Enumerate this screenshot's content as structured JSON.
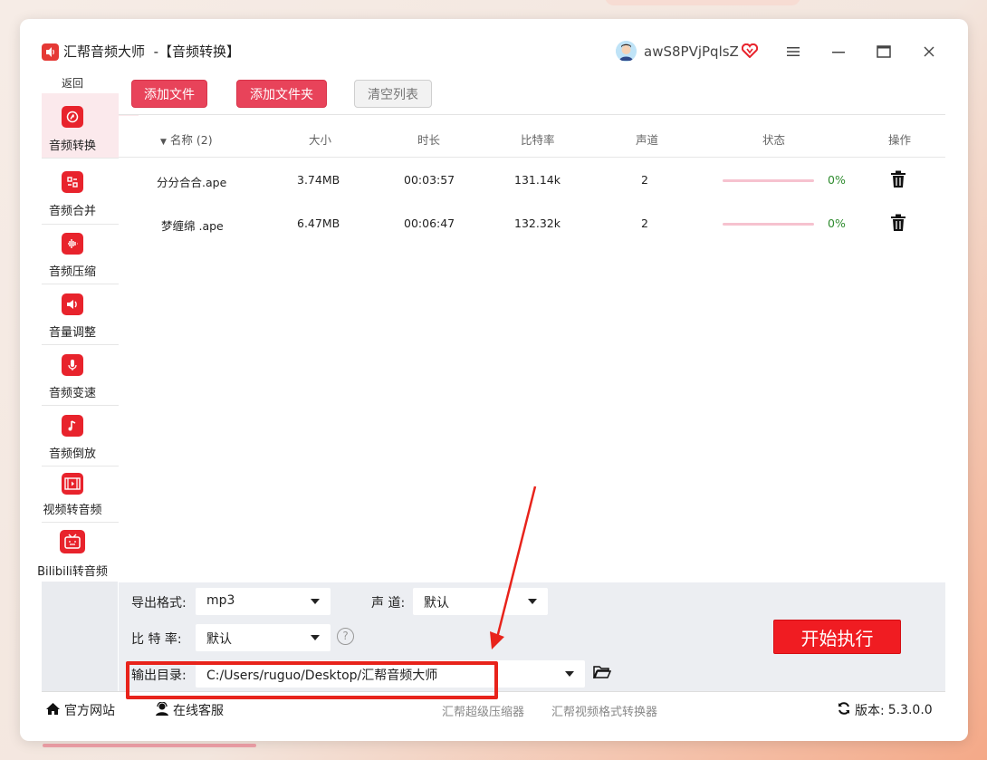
{
  "app": {
    "title": "汇帮音频大师",
    "subtitle": "-【音频转换】",
    "username": "awS8PVjPqlsZ",
    "accent_color": "#e8435a",
    "icons": [
      "app-logo-icon",
      "avatar",
      "vip-heart-icon",
      "menu-icon",
      "minimize-icon",
      "maximize-icon",
      "close-icon"
    ]
  },
  "sidebar": {
    "back_label": "返回",
    "items": [
      {
        "label": "音频转换",
        "icon": "audio-convert-icon",
        "active": true
      },
      {
        "label": "音频合并",
        "icon": "audio-merge-icon"
      },
      {
        "label": "音频压缩",
        "icon": "audio-compress-icon"
      },
      {
        "label": "音量调整",
        "icon": "volume-icon"
      },
      {
        "label": "音频变速",
        "icon": "microphone-icon"
      },
      {
        "label": "音频倒放",
        "icon": "music-note-icon"
      },
      {
        "label": "视频转音频",
        "icon": "video-icon"
      },
      {
        "label": "Bilibili转音频",
        "icon": "bilibili-tv-icon"
      }
    ]
  },
  "toolbar": {
    "add_file": "添加文件",
    "add_folder": "添加文件夹",
    "clear_list": "清空列表"
  },
  "table": {
    "columns": [
      "名称 (2)",
      "大小",
      "时长",
      "比特率",
      "声道",
      "状态",
      "操作"
    ],
    "rows": [
      {
        "name": "分分合合.ape",
        "size": "3.74MB",
        "duration": "00:03:57",
        "bitrate": "131.14k",
        "channels": "2",
        "progress": 0,
        "progress_text": "0%"
      },
      {
        "name": "梦缠绵 .ape",
        "size": "6.47MB",
        "duration": "00:06:47",
        "bitrate": "132.32k",
        "channels": "2",
        "progress": 0,
        "progress_text": "0%"
      }
    ]
  },
  "settings": {
    "format_label": "导出格式:",
    "format_value": "mp3",
    "channel_label": "声 道:",
    "channel_value": "默认",
    "bitrate_label": "比 特 率:",
    "bitrate_value": "默认",
    "help_glyph": "?",
    "output_label": "输出目录:",
    "output_value": "C:/Users/ruguo/Desktop/汇帮音频大师",
    "start_label": "开始执行"
  },
  "footer": {
    "website": "官方网站",
    "support": "在线客服",
    "link1": "汇帮超级压缩器",
    "link2": "汇帮视频格式转换器",
    "version_label": "版本:",
    "version_value": "5.3.0.0"
  },
  "annotation_color": "#e8231b"
}
